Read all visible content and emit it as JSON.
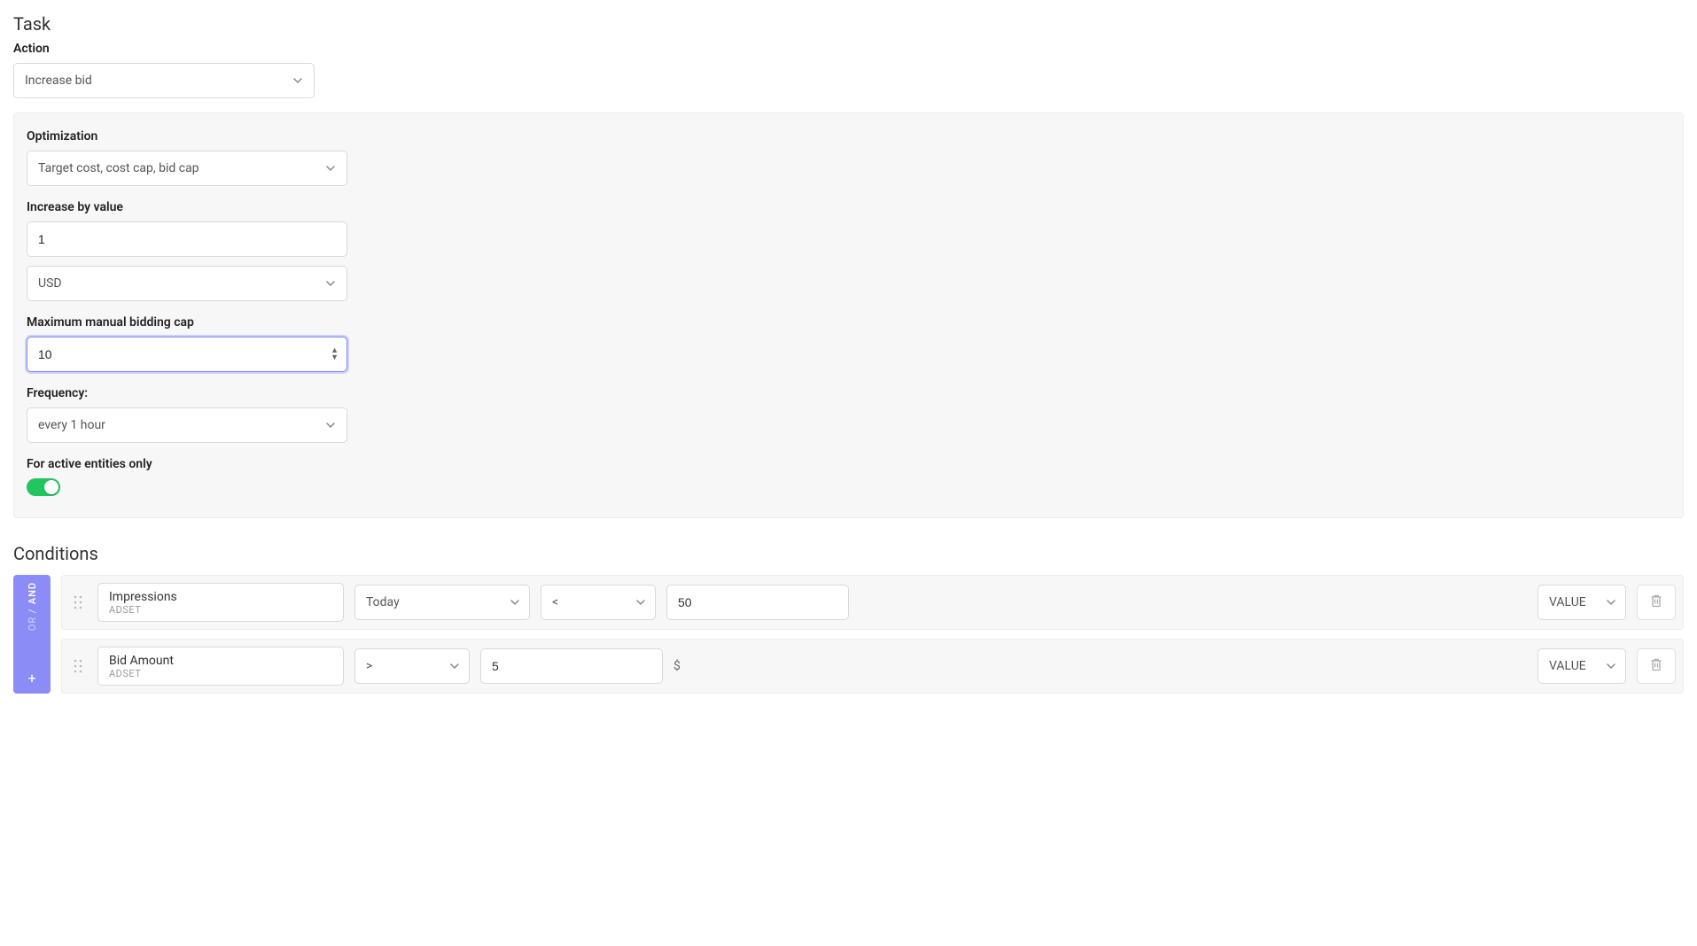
{
  "task": {
    "title": "Task",
    "action_label": "Action",
    "action_value": "Increase bid"
  },
  "optimization": {
    "label": "Optimization",
    "value": "Target cost, cost cap, bid cap",
    "increase_by_label": "Increase by value",
    "increase_by_value": "1",
    "currency": "USD",
    "max_cap_label": "Maximum manual bidding cap",
    "max_cap_value": "10",
    "frequency_label": "Frequency:",
    "frequency_value": "every 1 hour",
    "active_only_label": "For active entities only"
  },
  "conditions": {
    "title": "Conditions",
    "logic_or": "OR",
    "logic_and": "AND",
    "plus": "+",
    "rows": [
      {
        "metric": "Impressions",
        "level": "ADSET",
        "timeframe": "Today",
        "operator": "<",
        "value": "50",
        "value_type": "VALUE",
        "unit": ""
      },
      {
        "metric": "Bid Amount",
        "level": "ADSET",
        "timeframe": "",
        "operator": ">",
        "value": "5",
        "value_type": "VALUE",
        "unit": "$"
      }
    ]
  }
}
